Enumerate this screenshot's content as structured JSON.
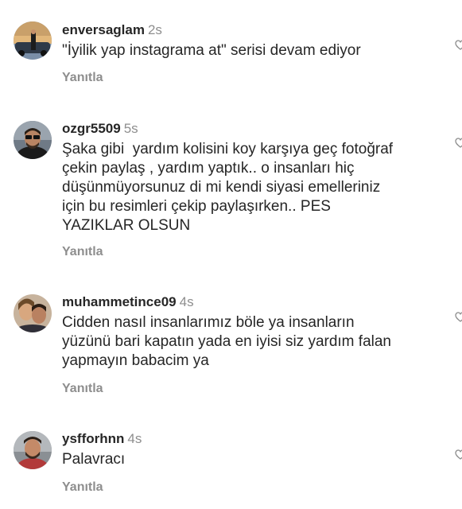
{
  "comments": [
    {
      "username": "enversaglam",
      "time": "2s",
      "text": "\"İyilik yap instagrama at\" serisi devam ediyor",
      "reply_label": "Yanıtla",
      "avatar_icon": "avatar-photo-person-car"
    },
    {
      "username": "ozgr5509",
      "time": "5s",
      "text": "Şaka gibi  yardım kolisini koy karşıya geç fotoğraf\nçekin paylaş , yardım yaptık.. o insanları hiç\ndüşünmüyorsunuz di mi kendi siyasi emelleriniz\niçin bu resimleri çekip paylaşırken.. PES\nYAZIKLAR OLSUN",
      "reply_label": "Yanıtla",
      "avatar_icon": "avatar-photo-man-glasses"
    },
    {
      "username": "muhammetince09",
      "time": "4s",
      "text": "Cidden nasıl insanlarımız böle ya insanların\nyüzünü bari kapatın yada en iyisi siz yardım falan\nyapmayın babacim ya",
      "reply_label": "Yanıtla",
      "avatar_icon": "avatar-photo-couple"
    },
    {
      "username": "ysfforhnn",
      "time": "4s",
      "text": "Palavracı",
      "reply_label": "Yanıtla",
      "avatar_icon": "avatar-photo-man-beard"
    }
  ],
  "icons": {
    "like": "heart-outline-icon"
  },
  "colors": {
    "text": "#262626",
    "secondary": "#8e8e8e",
    "background": "#ffffff"
  }
}
